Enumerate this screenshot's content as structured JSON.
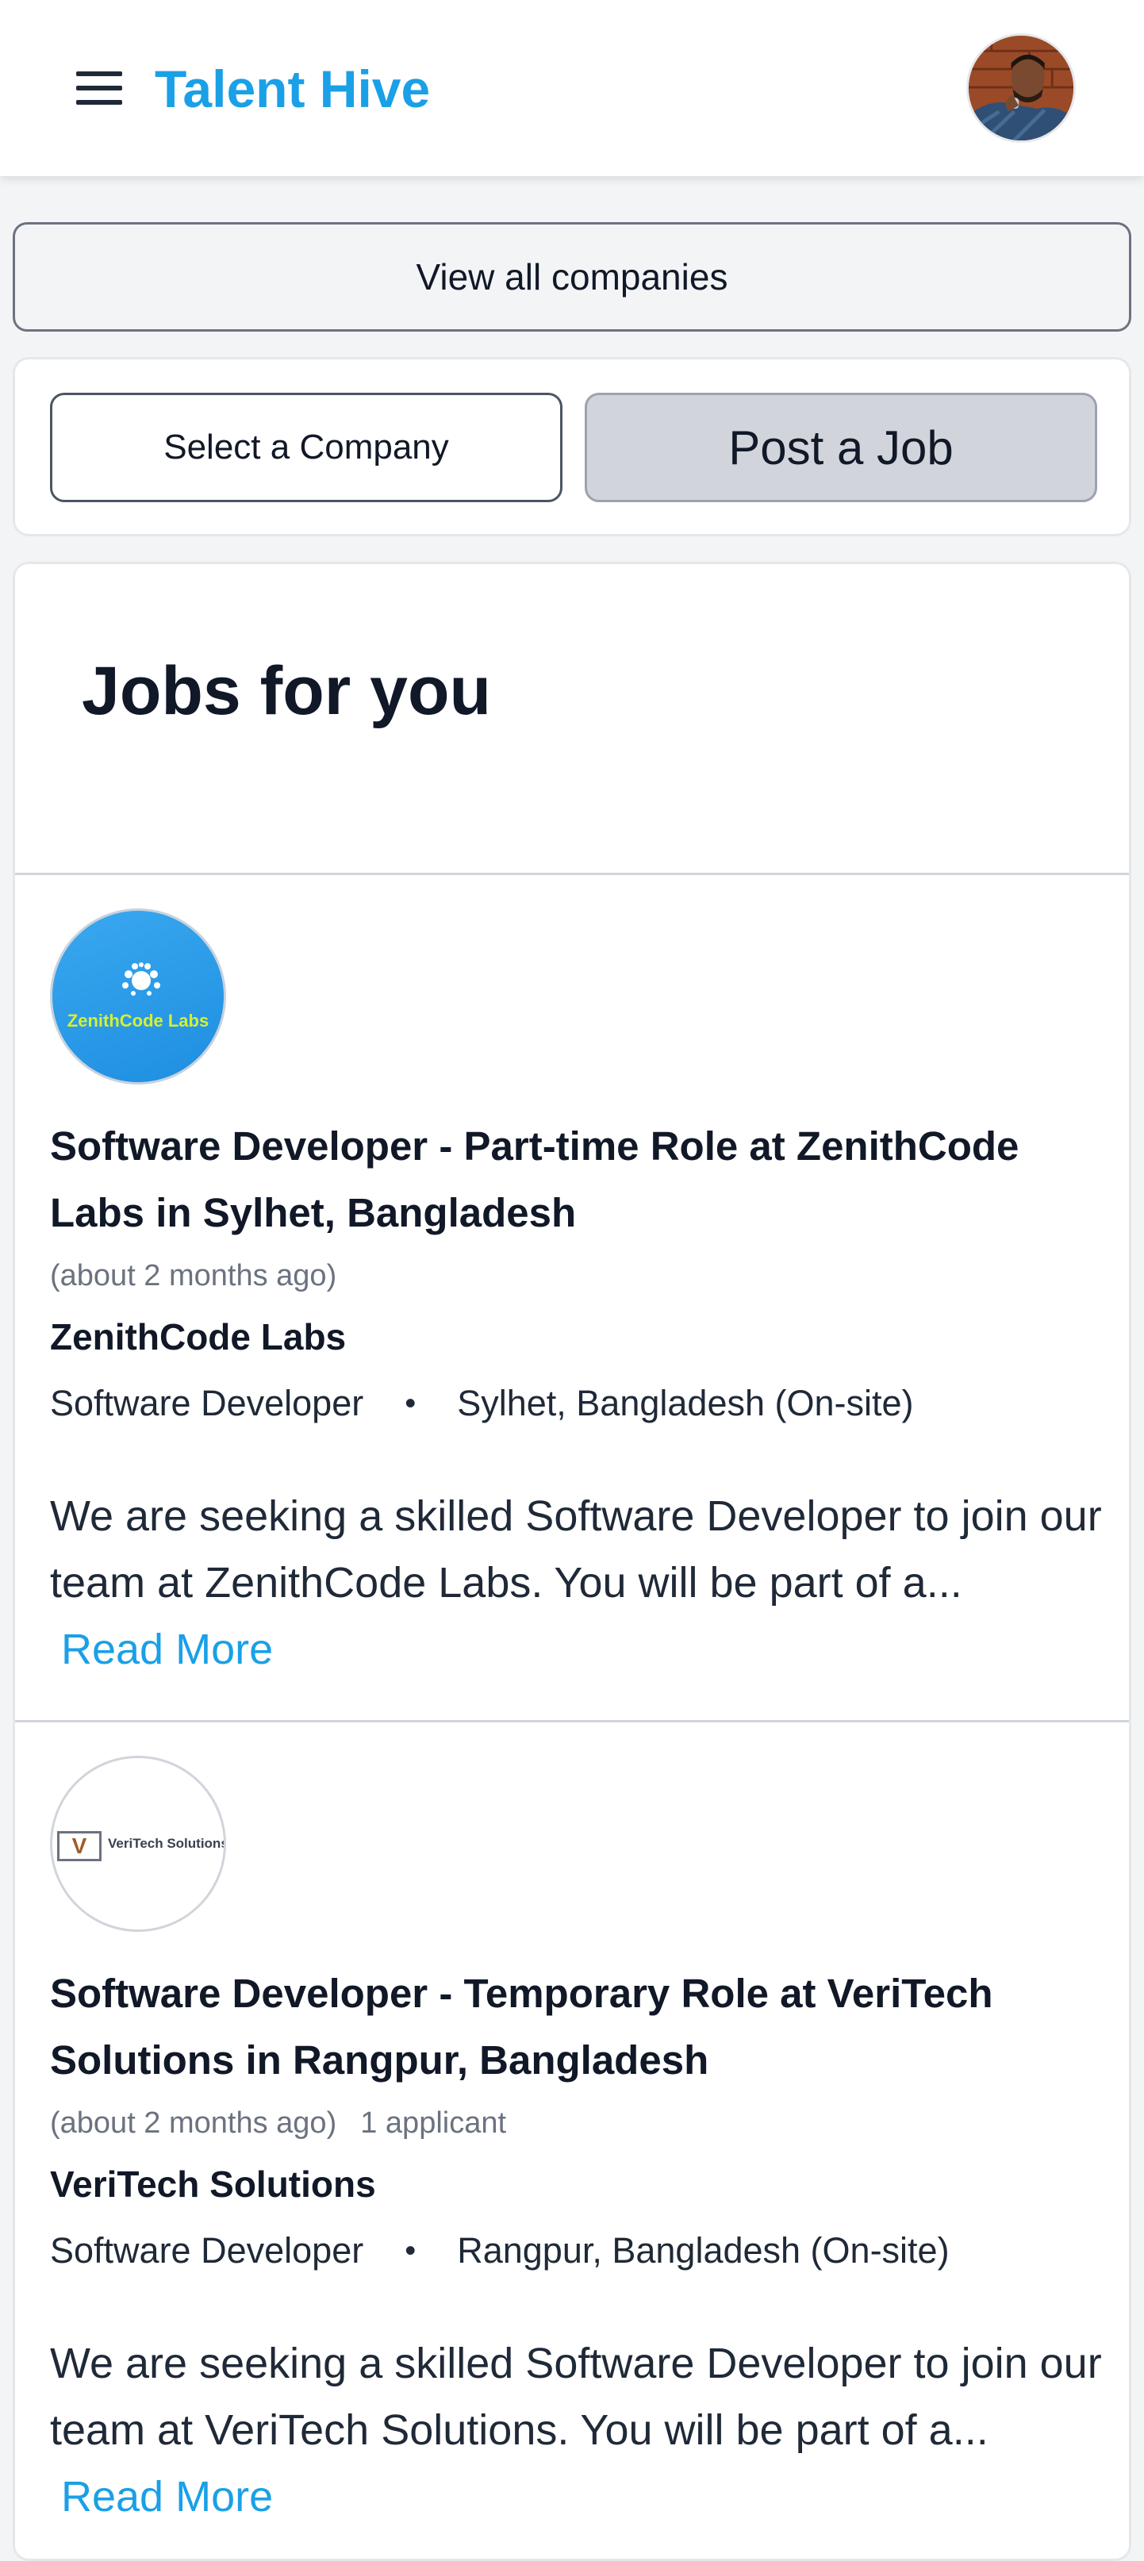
{
  "header": {
    "brand": "Talent Hive",
    "menu_icon": "hamburger-menu-icon",
    "avatar_icon": "user-avatar"
  },
  "view_all_companies": "View all companies",
  "actions": {
    "select_company": "Select a Company",
    "post_job": "Post a Job"
  },
  "feed": {
    "title": "Jobs for you",
    "jobs": [
      {
        "logo_text": "ZenithCode Labs",
        "title": "Software Developer - Part-time Role at ZenithCode Labs in Sylhet, Bangladesh",
        "posted": "(about 2 months ago)",
        "applicants": "",
        "company": "ZenithCode Labs",
        "role": "Software Developer",
        "separator": "•",
        "location": "Sylhet, Bangladesh (On-site)",
        "description": "We are seeking a skilled Software Developer to join our team at ZenithCode Labs. You will be part of a...",
        "read_more": "Read More"
      },
      {
        "logo_mark": "V",
        "logo_text": "VeriTech Solutions",
        "title": "Software Developer - Temporary Role at VeriTech Solutions in Rangpur, Bangladesh",
        "posted": "(about 2 months ago)",
        "applicants": "1 applicant",
        "company": "VeriTech Solutions",
        "role": "Software Developer",
        "separator": "•",
        "location": "Rangpur, Bangladesh (On-site)",
        "description": "We are seeking a skilled Software Developer to join our team at VeriTech Solutions. You will be part of a...",
        "read_more": "Read More"
      }
    ]
  },
  "colors": {
    "brand": "#1aa0e6",
    "link": "#1aa0e6",
    "page_bg": "#f3f4f6",
    "post_job_bg": "#d1d5db"
  }
}
